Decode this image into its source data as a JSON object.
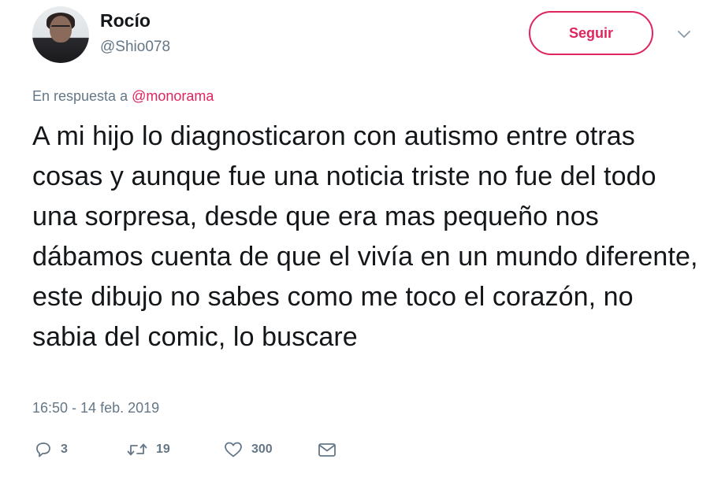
{
  "user": {
    "name": "Rocío",
    "handle": "@Shio078"
  },
  "follow_button": {
    "label": "Seguir"
  },
  "reply": {
    "prefix": "En respuesta a",
    "mention": "@monorama"
  },
  "tweet": {
    "text": "A mi hijo lo diagnosticaron con autismo entre otras cosas y aunque fue una noticia triste no fue del todo una sorpresa, desde que era mas pequeño nos dábamos cuenta de que el vivía en un mundo diferente, este dibujo no sabes como me toco el corazón, no sabia del comic, lo buscare",
    "timestamp": "16:50 - 14 feb. 2019"
  },
  "actions": {
    "replies": "3",
    "retweets": "19",
    "likes": "300"
  },
  "icons": {
    "more": "chevron-down-icon",
    "reply": "reply-icon",
    "retweet": "retweet-icon",
    "like": "heart-icon",
    "message": "envelope-icon"
  },
  "colors": {
    "accent": "#e0245e",
    "secondary_text": "#657786",
    "primary_text": "#14171a"
  }
}
